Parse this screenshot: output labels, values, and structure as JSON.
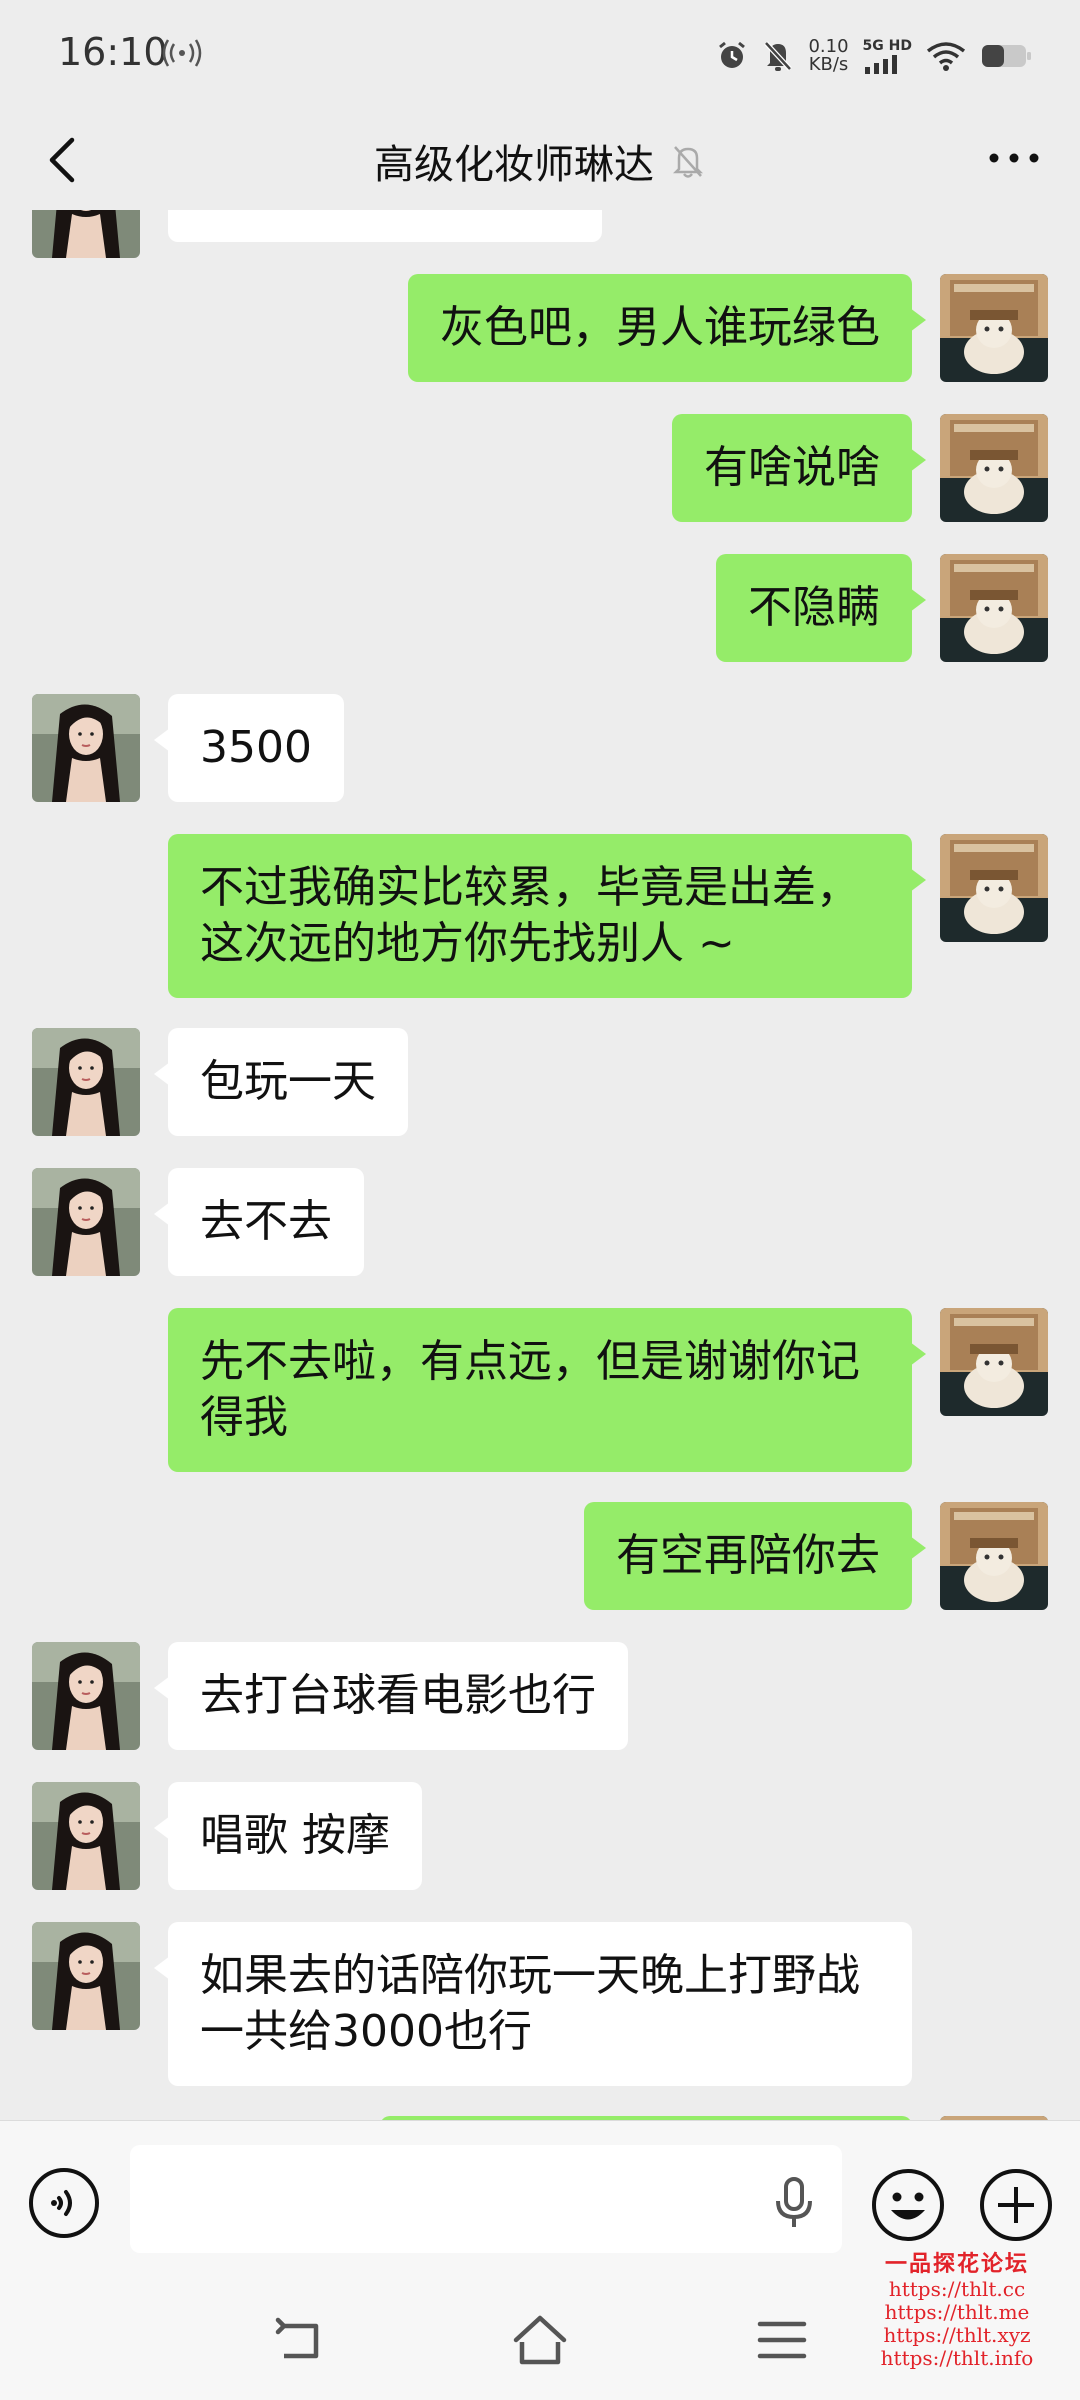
{
  "status_bar": {
    "time": "16:10",
    "net_speed_value": "0.10",
    "net_speed_unit": "KB/s",
    "network_type": "5G HD",
    "icons": [
      "nfc-icon",
      "alarm-icon",
      "mute-icon",
      "signal-icon",
      "wifi-icon",
      "battery-icon"
    ]
  },
  "header": {
    "title": "高级化妆师琳达",
    "muted": true,
    "icons": [
      "back-icon",
      "mute-bell-icon",
      "more-icon"
    ]
  },
  "messages": [
    {
      "sender": "me",
      "text": "灰色吧，男人谁玩绿色"
    },
    {
      "sender": "me",
      "text": "有啥说啥"
    },
    {
      "sender": "me",
      "text": "不隐瞒"
    },
    {
      "sender": "other",
      "text": "3500"
    },
    {
      "sender": "me",
      "text": "不过我确实比较累，毕竟是出差，这次远的地方你先找别人 ~"
    },
    {
      "sender": "other",
      "text": "包玩一天"
    },
    {
      "sender": "other",
      "text": "去不去"
    },
    {
      "sender": "me",
      "text": "先不去啦，有点远，但是谢谢你记得我"
    },
    {
      "sender": "me",
      "text": "有空再陪你去"
    },
    {
      "sender": "other",
      "text": "去打台球看电影也行"
    },
    {
      "sender": "other",
      "text": "唱歌 按摩"
    },
    {
      "sender": "other",
      "text": "如果去的话陪你玩一天晚上打野战一共给3000也行"
    }
  ],
  "input_bar": {
    "value": "",
    "icons": [
      "voice-icon",
      "mic-icon",
      "emoji-icon",
      "plus-icon"
    ]
  },
  "nav_bar": {
    "icons": [
      "nav-back-icon",
      "nav-home-icon",
      "nav-menu-icon"
    ]
  },
  "watermark": {
    "title": "一品探花论坛",
    "urls": [
      "https://thlt.cc",
      "https://thlt.me",
      "https://thlt.xyz",
      "https://thlt.info"
    ]
  },
  "colors": {
    "background": "#ededed",
    "my_bubble": "#95ec69",
    "other_bubble": "#ffffff",
    "watermark": "#e2232a"
  }
}
